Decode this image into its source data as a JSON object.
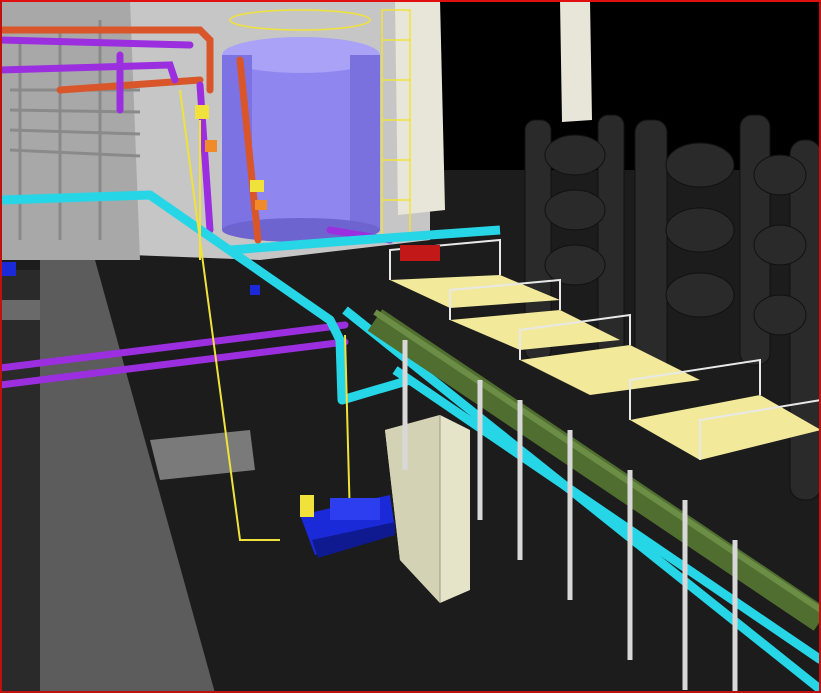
{
  "scene": {
    "kind": "3d-plant-model-view",
    "colors": {
      "floor": "#1c1c1c",
      "walkway": "#5a5a5a",
      "wall": "#c8c8c8",
      "sky": "#000000",
      "tank": "#8f86f0",
      "pipe_cyan": "#27d6e6",
      "pipe_purple": "#9b2fe0",
      "pipe_orange": "#d9562a",
      "pipe_green": "#4f6e2f",
      "pipe_yellow": "#f0e23a",
      "vessels": "#2a2a2a",
      "pump": "#1a2ad8",
      "cabinet": "#e6e4c8",
      "grating": "#f2ea9a",
      "railing": "#e8e8e8",
      "frame_border": "#e01010"
    },
    "objects": [
      "storage-tank",
      "filter-vessel-bank",
      "pump-skid",
      "electrical-cabinet",
      "pipe-rack",
      "platforms"
    ]
  }
}
